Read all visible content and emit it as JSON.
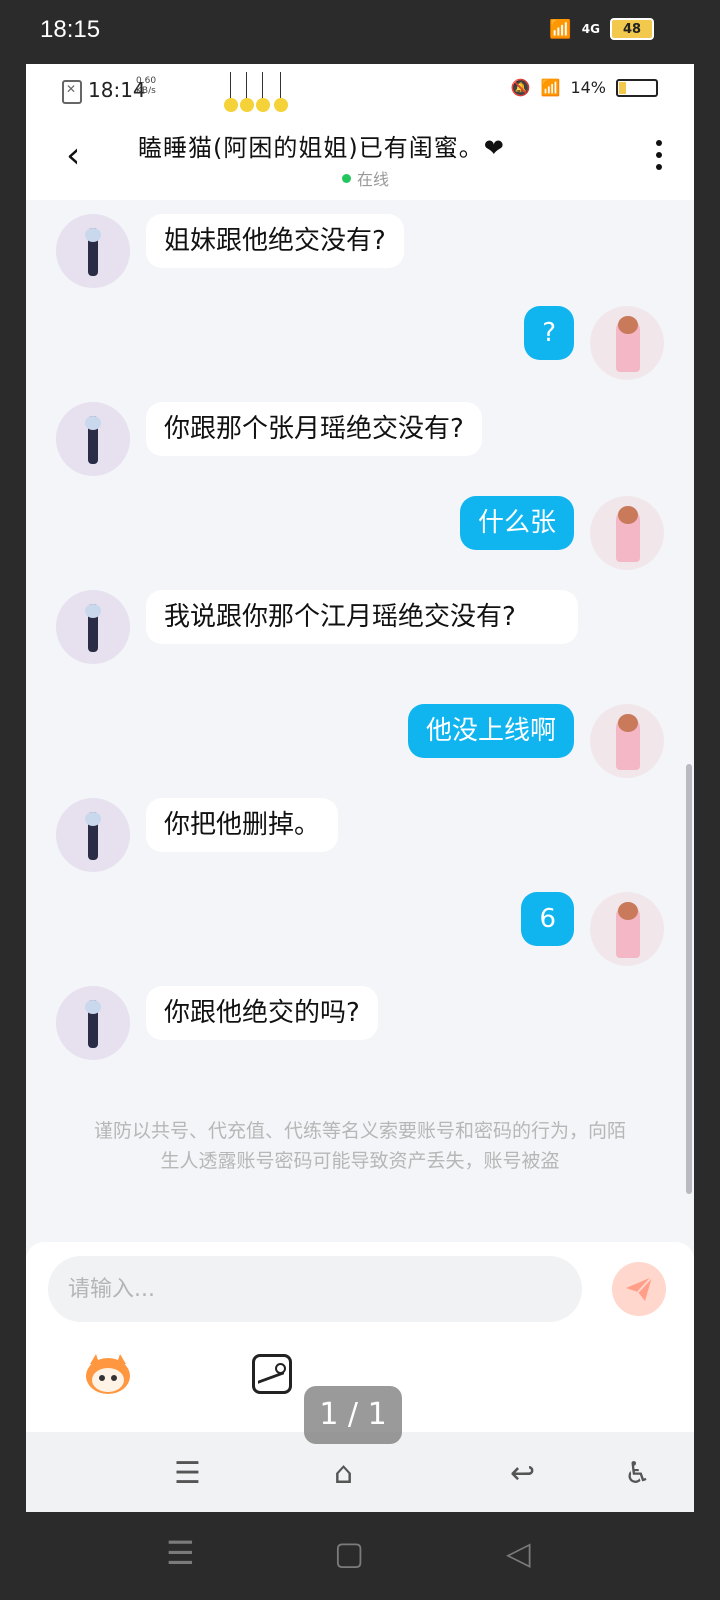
{
  "outer_status": {
    "time": "18:15",
    "network": "4G",
    "battery": "48"
  },
  "inner_status": {
    "time": "18:14",
    "speed_value": "0.60",
    "speed_unit": "KB/s",
    "battery": "14%"
  },
  "header": {
    "title": "瞌睡猫(阿困的姐姐)已有闺蜜。❤",
    "status": "在线"
  },
  "messages": [
    {
      "side": "left",
      "text": "姐妹跟他绝交没有?"
    },
    {
      "side": "right",
      "text": "?"
    },
    {
      "side": "left",
      "text": "你跟那个张月瑶绝交没有?"
    },
    {
      "side": "right",
      "text": "什么张"
    },
    {
      "side": "left",
      "text": "我说跟你那个江月瑶绝交没有?"
    },
    {
      "side": "right",
      "text": "他没上线啊"
    },
    {
      "side": "left",
      "text": "你把他删掉。"
    },
    {
      "side": "right",
      "text": "6"
    },
    {
      "side": "left",
      "text": "你跟他绝交的吗?"
    }
  ],
  "notice": "谨防以共号、代充值、代练等名义索要账号和密码的行为，向陌生人透露账号密码可能导致资产丢失，账号被盗",
  "input": {
    "placeholder": "请输入..."
  },
  "page_indicator": "1 / 1",
  "icons": {
    "back": "back-arrow-icon",
    "more": "more-vertical-icon",
    "send": "send-icon",
    "mascot": "mascot-icon",
    "image": "image-icon"
  },
  "colors": {
    "my_bubble": "#10b5f0",
    "their_bubble": "#ffffff",
    "online_dot": "#22c55e",
    "send_button": "#ffd7cc"
  }
}
